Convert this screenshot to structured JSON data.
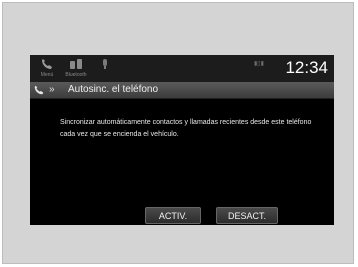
{
  "status_bar": {
    "items": [
      {
        "label": "Menú",
        "icon": "phone-icon"
      },
      {
        "label": "Bluetooth",
        "icon": "bluetooth-devices-icon"
      },
      {
        "label": "",
        "icon": "microphone-icon"
      }
    ],
    "signal_text": "▮▯▮",
    "time": "12:34"
  },
  "title_bar": {
    "icon": "phone-icon",
    "chevron": "»",
    "title": "Autosinc. el teléfono"
  },
  "message": "Sincronizar automáticamente contactos y llamadas recientes desde este teléfono cada vez que se encienda el vehículo.",
  "buttons": {
    "on_label": "ACTIV.",
    "off_label": "DESACT."
  }
}
